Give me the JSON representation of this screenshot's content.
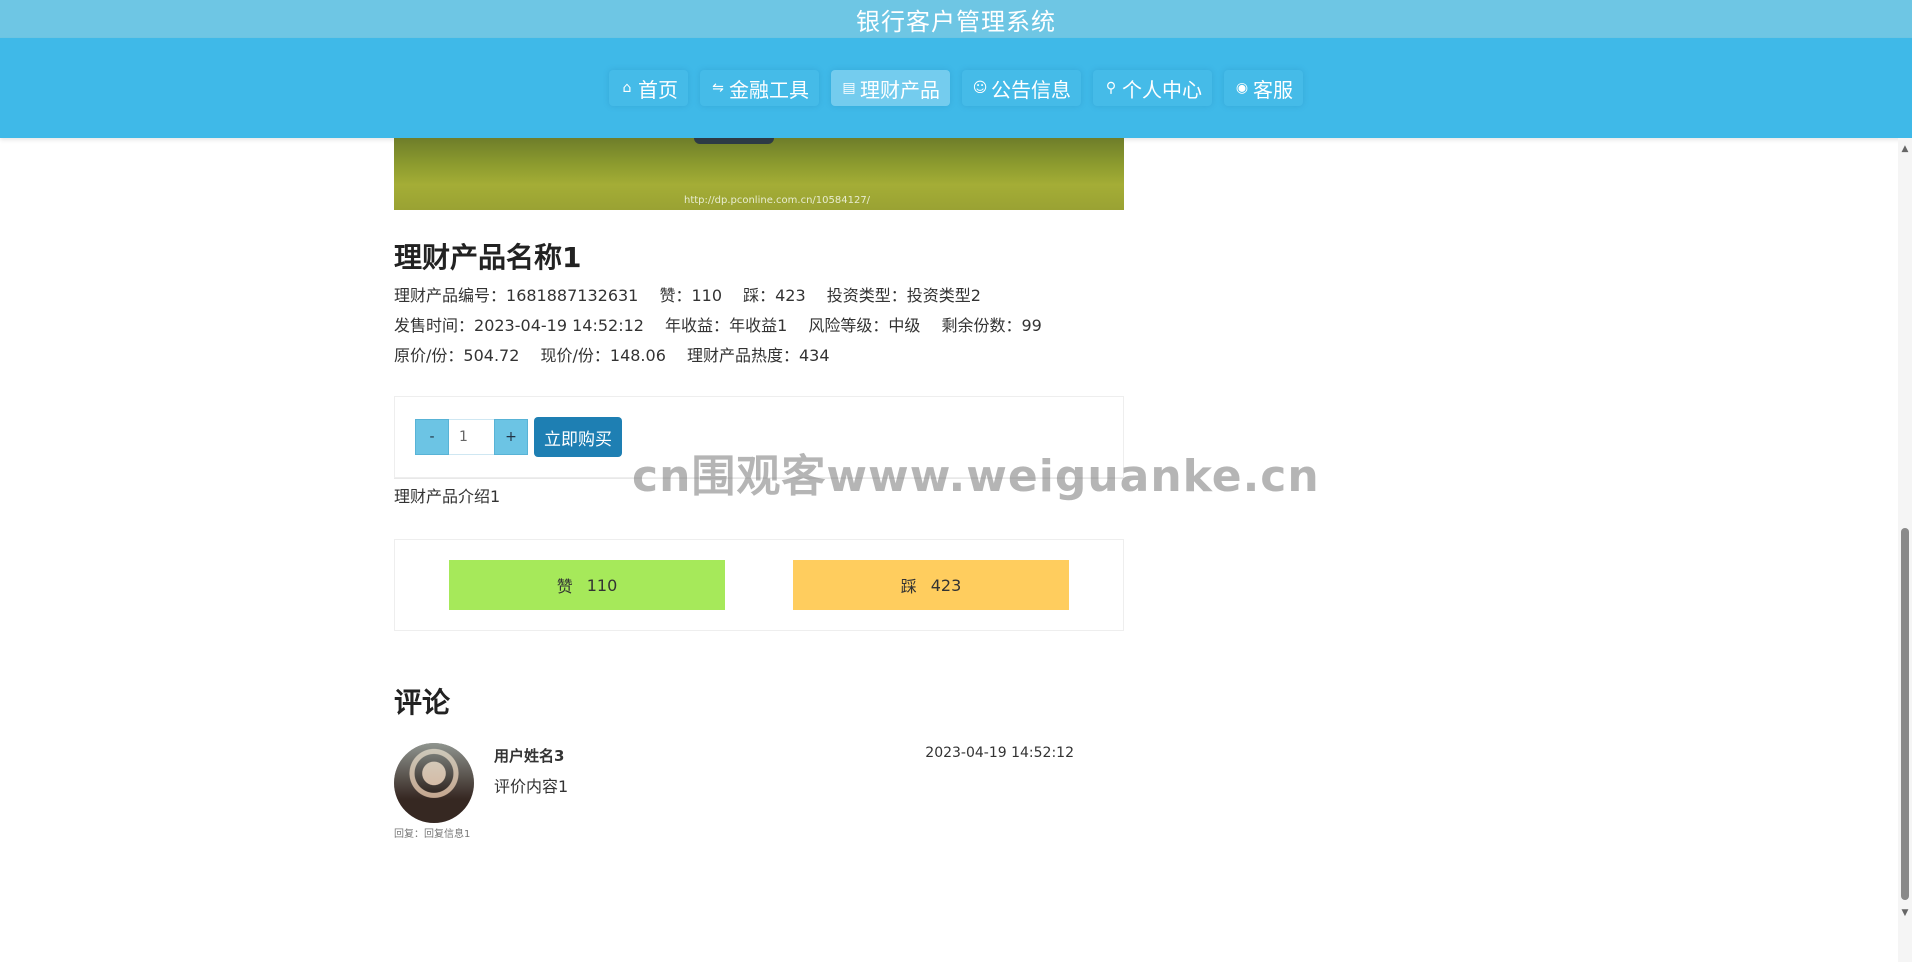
{
  "header": {
    "title": "银行客户管理系统"
  },
  "nav": {
    "items": [
      {
        "label": "首页",
        "icon": "home-icon",
        "glyph": "⌂",
        "active": false
      },
      {
        "label": "金融工具",
        "icon": "exchange-icon",
        "glyph": "⇋",
        "active": false
      },
      {
        "label": "理财产品",
        "icon": "document-icon",
        "glyph": "▤",
        "active": true
      },
      {
        "label": "公告信息",
        "icon": "smile-icon",
        "glyph": "☺",
        "active": false
      },
      {
        "label": "个人中心",
        "icon": "user-icon",
        "glyph": "⚲",
        "active": false
      },
      {
        "label": "客服",
        "icon": "support-icon",
        "glyph": "◉",
        "active": false
      }
    ]
  },
  "hero": {
    "caption": "http://dp.pconline.com.cn/10584127/"
  },
  "product": {
    "name": "理财产品名称1",
    "code_label": "理财产品编号：",
    "code": "1681887132631",
    "like_label": "赞：",
    "likes": "110",
    "dislike_label": "踩：",
    "dislikes": "423",
    "type_label": "投资类型：",
    "type": "投资类型2",
    "sale_time_label": "发售时间：",
    "sale_time": "2023-04-19 14:52:12",
    "annual_label": "年收益：",
    "annual": "年收益1",
    "risk_label": "风险等级：",
    "risk": "中级",
    "remaining_label": "剩余份数：",
    "remaining": "99",
    "orig_price_label": "原价/份：",
    "orig_price": "504.72",
    "cur_price_label": "现价/份：",
    "cur_price": "148.06",
    "heat_label": "理财产品热度：",
    "heat": "434",
    "intro": "理财产品介绍1"
  },
  "purchase": {
    "minus": "-",
    "plus": "+",
    "quantity": "1",
    "buy_label": "立即购买"
  },
  "votes": {
    "like_label": "赞",
    "like_count": "110",
    "dislike_label": "踩",
    "dislike_count": "423"
  },
  "comments": {
    "title": "评论",
    "items": [
      {
        "user": "用户姓名3",
        "time": "2023-04-19 14:52:12",
        "content": "评价内容1",
        "reply": "回复：回复信息1"
      }
    ]
  },
  "watermark": "cn围观客www.weiguanke.cn",
  "scrollbar": {
    "up": "▲",
    "down": "▼"
  }
}
